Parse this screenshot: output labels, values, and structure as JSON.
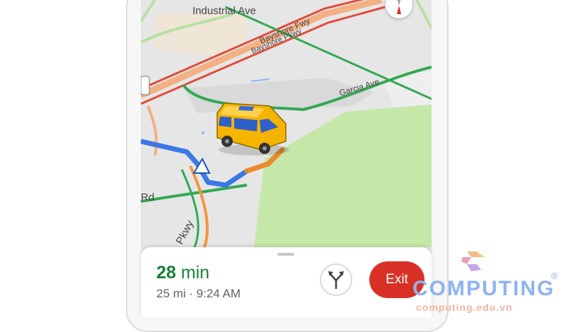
{
  "map": {
    "streets": {
      "industrial": "Industrial Ave",
      "bayshore_fwy": "Bayshore Fwy",
      "bayshore_pkwy": "Bayshore Pkwy",
      "garcia": "Garcia Ave",
      "rd": "Rd",
      "pkwy": "Pkwy"
    },
    "colors": {
      "route": "#3b78e7",
      "traffic_slow": "#f2963c",
      "traffic_clear": "#34a853",
      "park": "#c5e8a8"
    }
  },
  "nav_sheet": {
    "eta_value": "28",
    "eta_unit": "min",
    "trip_info": "25 mi · 9:24 AM",
    "exit_label": "Exit",
    "alt_routes_icon": "fork-arrows-icon"
  },
  "watermark": {
    "brand": "COMPUTING",
    "registered": "®",
    "url": "computing.edu.vn"
  }
}
